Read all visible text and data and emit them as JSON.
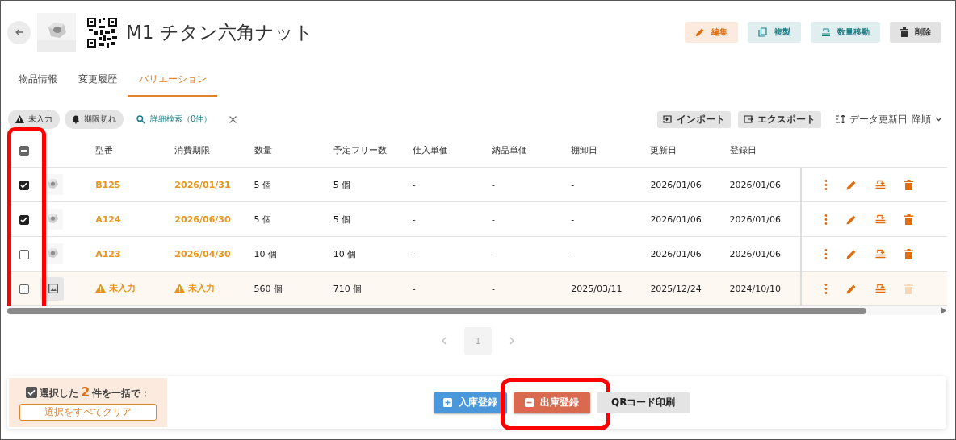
{
  "header": {
    "title": "M1 チタン六角ナット",
    "actions": [
      {
        "label": "編集",
        "kind": "edit"
      },
      {
        "label": "複製",
        "kind": "copy"
      },
      {
        "label": "数量移動",
        "kind": "move"
      },
      {
        "label": "削除",
        "kind": "delete"
      }
    ]
  },
  "tabs": [
    {
      "label": "物品情報",
      "selected": false
    },
    {
      "label": "変更履歴",
      "selected": false
    },
    {
      "label": "バリエーション",
      "selected": true
    }
  ],
  "filters": {
    "chips": [
      {
        "label": "未入力",
        "kind": "warning"
      },
      {
        "label": "期限切れ",
        "kind": "bell"
      }
    ],
    "search_link": "詳細検索（0件）"
  },
  "tools": {
    "import": "インポート",
    "export": "エクスポート",
    "sort_field": "データ更新日",
    "sort_order": "降順"
  },
  "table": {
    "checkbox_column_callout": true,
    "select_all_indeterminate": true,
    "columns": [
      "型番",
      "消費期限",
      "数量",
      "予定フリー数",
      "仕入単価",
      "納品単価",
      "棚卸日",
      "更新日",
      "登録日"
    ],
    "rows": [
      {
        "checked": true,
        "kind": "picture",
        "cells": [
          "B125",
          "2026/01/31",
          "5 個",
          "5 個",
          "-",
          "-",
          "-",
          "2026/01/06",
          "2026/01/06"
        ],
        "model_missing": false,
        "expiry_missing": false,
        "highlighted": false,
        "delete_disabled": false
      },
      {
        "checked": true,
        "kind": "picture",
        "cells": [
          "A124",
          "2026/06/30",
          "5 個",
          "5 個",
          "-",
          "-",
          "-",
          "2026/01/06",
          "2026/01/06"
        ],
        "model_missing": false,
        "expiry_missing": false,
        "highlighted": false,
        "delete_disabled": false
      },
      {
        "checked": false,
        "kind": "picture",
        "cells": [
          "A123",
          "2026/04/30",
          "10 個",
          "10 個",
          "-",
          "-",
          "-",
          "2026/01/06",
          "2026/01/06"
        ],
        "model_missing": false,
        "expiry_missing": false,
        "highlighted": false,
        "delete_disabled": false
      },
      {
        "checked": false,
        "kind": "placeholder",
        "cells": [
          "未入力",
          "未入力",
          "560 個",
          "710 個",
          "-",
          "-",
          "2025/03/11",
          "2025/12/24",
          "2024/10/10"
        ],
        "model_missing": true,
        "expiry_missing": true,
        "highlighted": true,
        "delete_disabled": true
      }
    ]
  },
  "pagination": {
    "pages": [
      {
        "label": "1",
        "selected": true
      }
    ]
  },
  "bulk": {
    "prefix": "選択した",
    "count": "2",
    "suffix": "件を一括で：",
    "clear": "選択をすべてクリア",
    "actions": [
      {
        "label": "入庫登録",
        "kind": "in",
        "callout": false
      },
      {
        "label": "出庫登録",
        "kind": "out",
        "callout": true
      },
      {
        "label": "QRコード印刷",
        "kind": "qr",
        "callout": false
      }
    ]
  }
}
